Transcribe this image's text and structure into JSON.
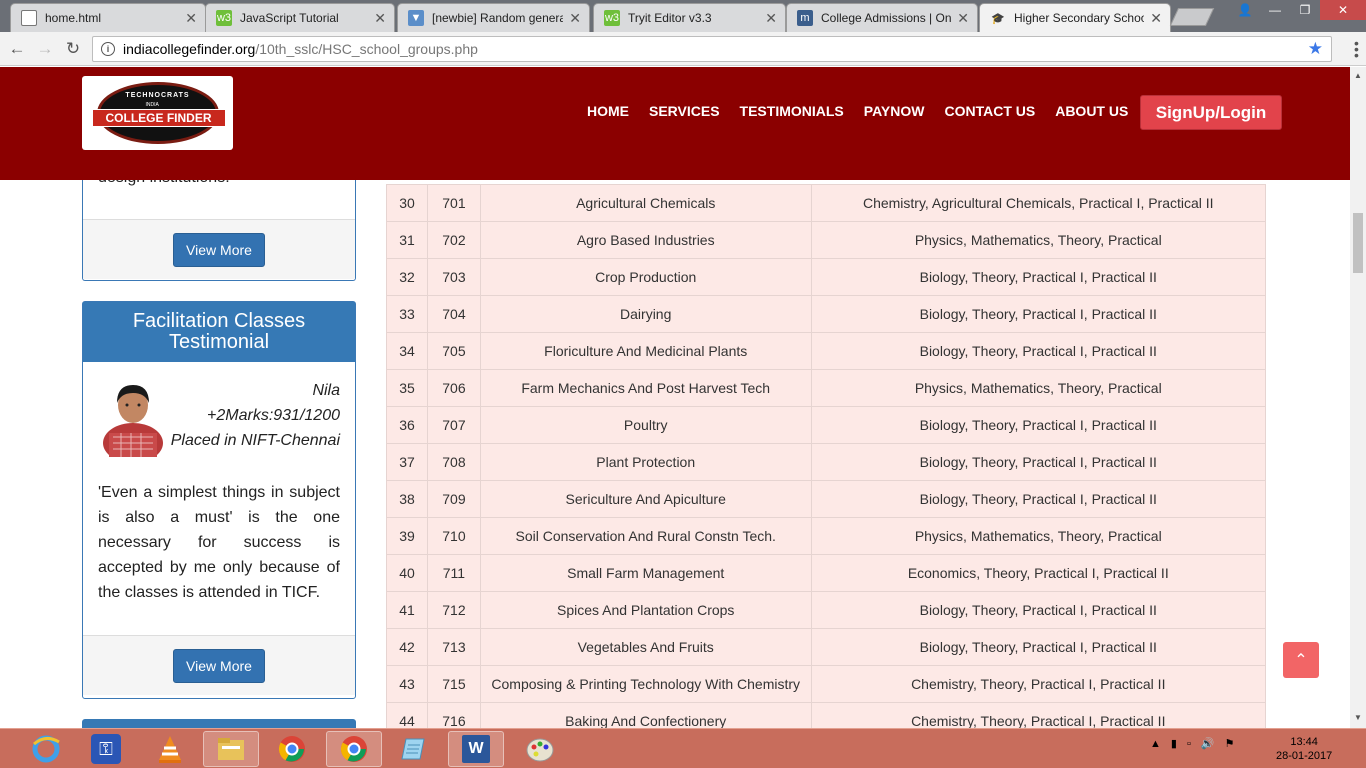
{
  "browser": {
    "tabs": [
      {
        "label": "home.html",
        "icon": "document-icon",
        "active": false
      },
      {
        "label": "JavaScript Tutorial",
        "icon": "w3schools-icon",
        "active": false
      },
      {
        "label": "[newbie] Random genera",
        "icon": "forum-icon",
        "active": false
      },
      {
        "label": "Tryit Editor v3.3",
        "icon": "w3schools-icon",
        "active": false
      },
      {
        "label": "College Admissions | Onl",
        "icon": "m-logo-icon",
        "active": false
      },
      {
        "label": "Higher Secondary Schoo",
        "icon": "graduation-cap-icon",
        "active": true
      }
    ],
    "url_host": "indiacollegefinder.org",
    "url_path": "/10th_sslc/HSC_school_groups.php"
  },
  "site": {
    "logo": {
      "top": "TECHNOCRATS",
      "sub": "INDIA",
      "band": "COLLEGE FINDER"
    },
    "nav": [
      "HOME",
      "SERVICES",
      "TESTIMONIALS",
      "PAYNOW",
      "CONTACT US",
      "ABOUT US"
    ],
    "signup_label": "SignUp/Login",
    "brand_color": "#8b0000"
  },
  "sidebar": {
    "top_panel": {
      "tail_text": "design institutions.",
      "button": "View More"
    },
    "testimonial": {
      "heading": "Facilitation Classes Testimonial",
      "name": "Nila",
      "marks": "+2Marks:931/1200",
      "placed": "Placed in NIFT-Chennai",
      "quote": "'Even a simplest things in subject is also a must' is the one necessary for success is accepted by me only because of the classes is attended in TICF.",
      "button": "View More"
    }
  },
  "table_rows": [
    [
      "30",
      "701",
      "Agricultural Chemicals",
      "Chemistry, Agricultural Chemicals, Practical I, Practical II"
    ],
    [
      "31",
      "702",
      "Agro Based Industries",
      "Physics, Mathematics, Theory, Practical"
    ],
    [
      "32",
      "703",
      "Crop Production",
      "Biology, Theory, Practical I, Practical II"
    ],
    [
      "33",
      "704",
      "Dairying",
      "Biology, Theory, Practical I, Practical II"
    ],
    [
      "34",
      "705",
      "Floriculture And Medicinal Plants",
      "Biology, Theory, Practical I, Practical II"
    ],
    [
      "35",
      "706",
      "Farm Mechanics And Post Harvest Tech",
      "Physics, Mathematics, Theory, Practical"
    ],
    [
      "36",
      "707",
      "Poultry",
      "Biology, Theory, Practical I, Practical II"
    ],
    [
      "37",
      "708",
      "Plant Protection",
      "Biology, Theory, Practical I, Practical II"
    ],
    [
      "38",
      "709",
      "Sericulture And Apiculture",
      "Biology, Theory, Practical I, Practical II"
    ],
    [
      "39",
      "710",
      "Soil Conservation And Rural Constn Tech.",
      "Physics, Mathematics, Theory, Practical"
    ],
    [
      "40",
      "711",
      "Small Farm Management",
      "Economics, Theory, Practical I, Practical II"
    ],
    [
      "41",
      "712",
      "Spices And Plantation Crops",
      "Biology, Theory, Practical I, Practical II"
    ],
    [
      "42",
      "713",
      "Vegetables And Fruits",
      "Biology, Theory, Practical I, Practical II"
    ],
    [
      "43",
      "715",
      "Composing & Printing Technology With Chemistry",
      "Chemistry, Theory, Practical I, Practical II"
    ],
    [
      "44",
      "716",
      "Baking And Confectionery",
      "Chemistry, Theory, Practical I, Practical II"
    ]
  ],
  "taskbar": {
    "apps": [
      "ie-icon",
      "key-icon",
      "vlc-icon",
      "file-explorer-icon",
      "chrome-icon",
      "chrome-icon",
      "notepad-icon",
      "word-icon",
      "paint-icon"
    ],
    "time": "13:44",
    "date": "28-01-2017"
  }
}
